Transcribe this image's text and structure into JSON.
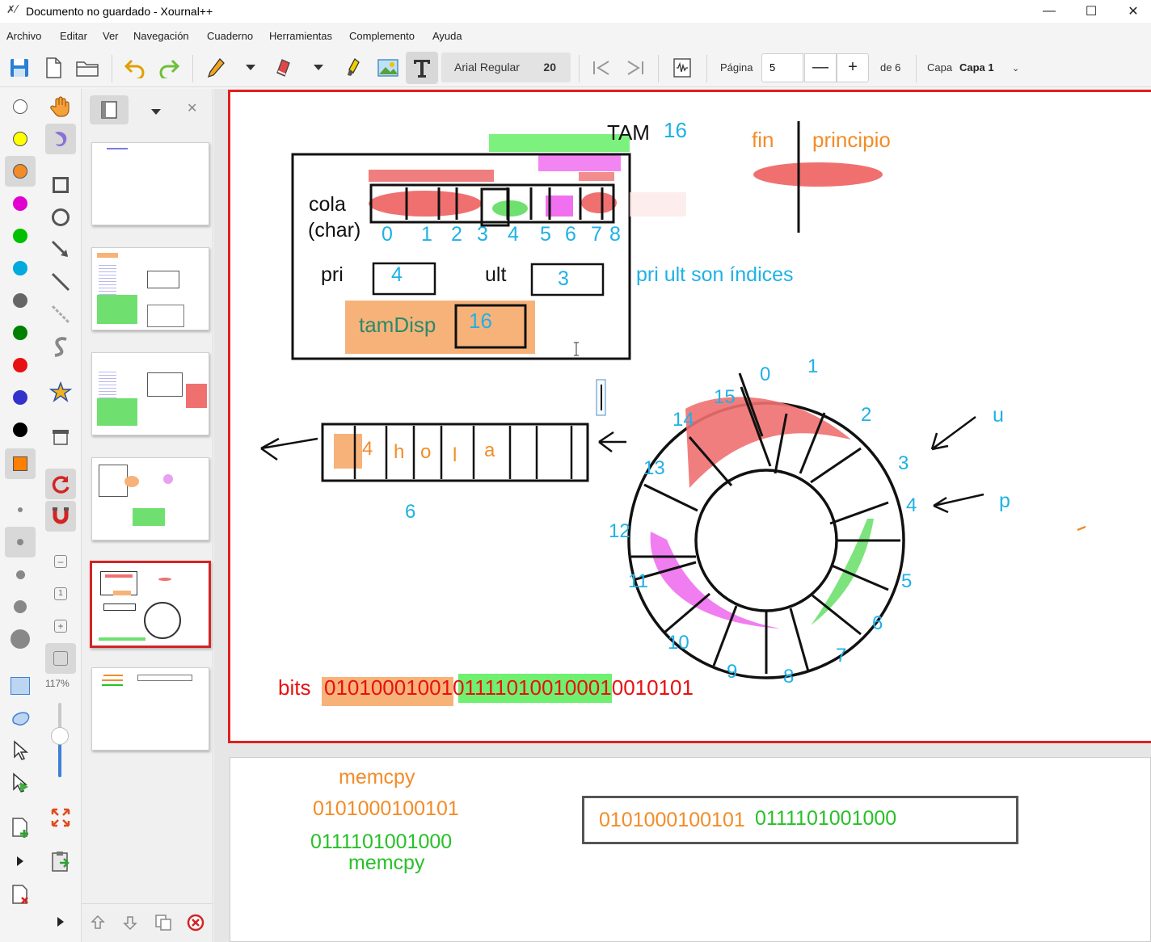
{
  "window": {
    "title": "Documento no guardado - Xournal++",
    "app_icon": "xournal-icon",
    "controls": {
      "minimize": "—",
      "maximize": "☐",
      "close": "✕"
    }
  },
  "menu": [
    "Archivo",
    "Editar",
    "Ver",
    "Navegación",
    "Cuaderno",
    "Herramientas",
    "Complemento",
    "Ayuda"
  ],
  "toolbar": {
    "font_name": "Arial Regular",
    "font_size": "20",
    "page_label": "Página",
    "page_value": "5",
    "minus": "—",
    "plus": "+",
    "page_of": "de 6",
    "layer_label": "Capa",
    "layer_value": "Capa 1",
    "layer_dropdown": "⌄"
  },
  "left_tools": {
    "zoom": "117%",
    "colors": [
      "#ffffff",
      "#ffff00",
      "#f28c28",
      "#e000d0",
      "#00c000",
      "#00aadd",
      "#666666",
      "#008000",
      "#ff0000",
      "#3333cc",
      "#000000",
      "#ff8000"
    ]
  },
  "sidebar": {
    "thumb_count": 6,
    "selected_page": 5
  },
  "page5": {
    "tam_label": "TAM",
    "tam_value": "16",
    "fin": "fin",
    "principio": "principio",
    "cola": "cola",
    "char": "(char)",
    "indices": [
      "0",
      "1",
      "2",
      "3",
      "4",
      "5",
      "6",
      "7",
      "8"
    ],
    "pri": "pri",
    "pri_value": "4",
    "ult": "ult",
    "ult_value": "3",
    "indices_note": "pri ult son índices",
    "tamdisp": "tamDisp",
    "tamdisp_value": "16",
    "buffer_chars": [
      "4",
      "h",
      "o",
      "l",
      "a"
    ],
    "buffer_count": "6",
    "ring_labels": [
      "0",
      "1",
      "2",
      "3",
      "4",
      "5",
      "6",
      "7",
      "8",
      "9",
      "10",
      "11",
      "12",
      "13",
      "14",
      "15"
    ],
    "u": "u",
    "p": "p",
    "bits_label": "bits",
    "bits_part1": "0101000100",
    "bits_part2": "1",
    "bits_part3": "0111101001000",
    "bits_part4": "10010101"
  },
  "page6": {
    "memcpy1": "memcpy",
    "bin1": "0101000100101",
    "bin2": "0111101001000",
    "memcpy2": "memcpy",
    "box_part1": "0101000100101",
    "box_part2": "0111101001000"
  }
}
